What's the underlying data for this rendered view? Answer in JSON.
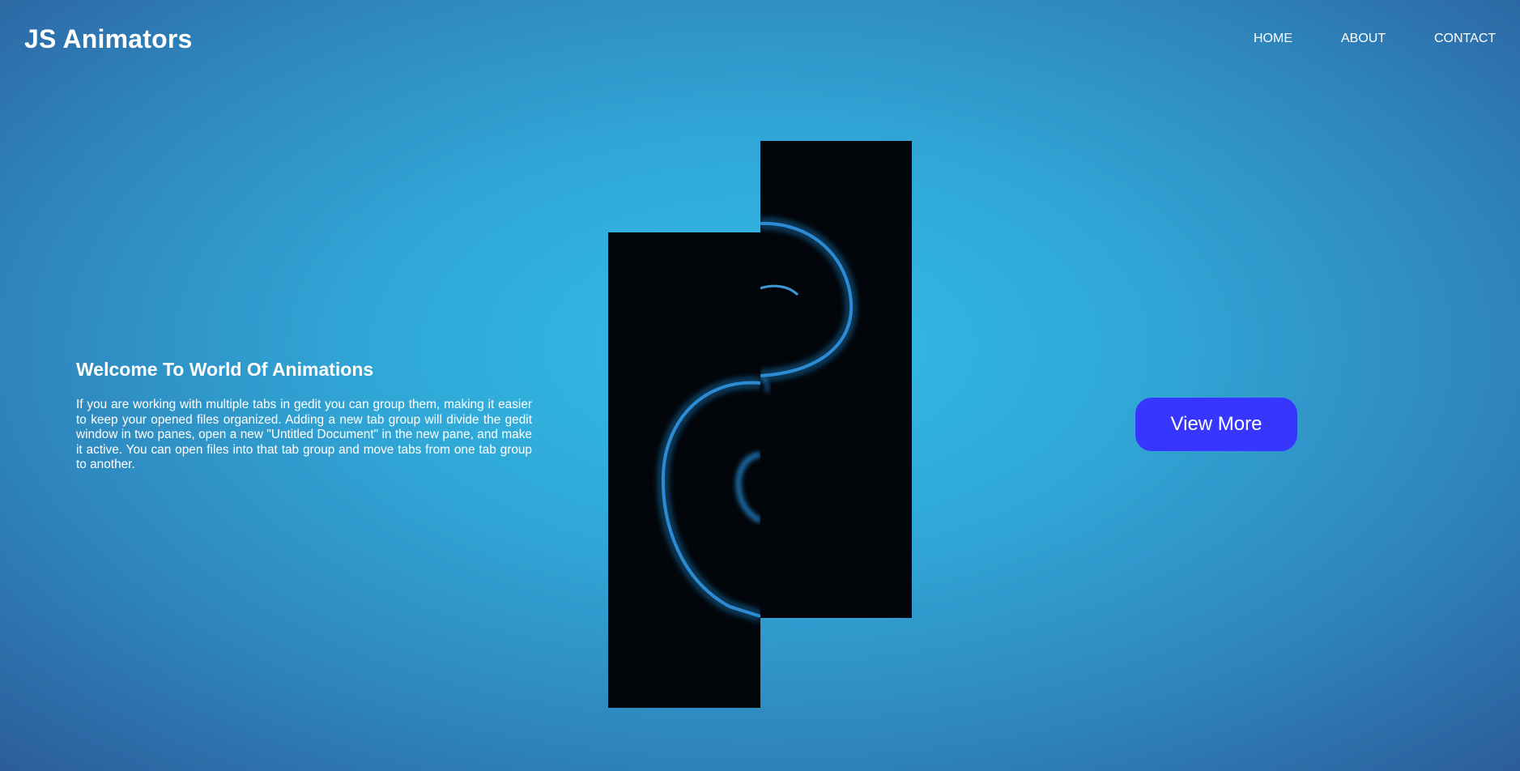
{
  "header": {
    "logo": "JS Animators",
    "nav": [
      {
        "label": "HOME"
      },
      {
        "label": "ABOUT"
      },
      {
        "label": "CONTACT"
      }
    ]
  },
  "hero": {
    "title": "Welcome To World Of Animations",
    "body": "If you are working with multiple tabs in gedit you can group them, making it easier to keep your opened files organized. Adding a new tab group will divide the gedit window in two panes, open a new \"Untitled Document\" in the new pane, and make it active. You can open files into that tab group and move tabs from one tab group to another.",
    "cta_label": "View More"
  },
  "colors": {
    "background_center": "#33bde6",
    "background_edge": "#2b5797",
    "button": "#3636ff",
    "panel": "#02060b",
    "glow": "#1e8fe0"
  }
}
